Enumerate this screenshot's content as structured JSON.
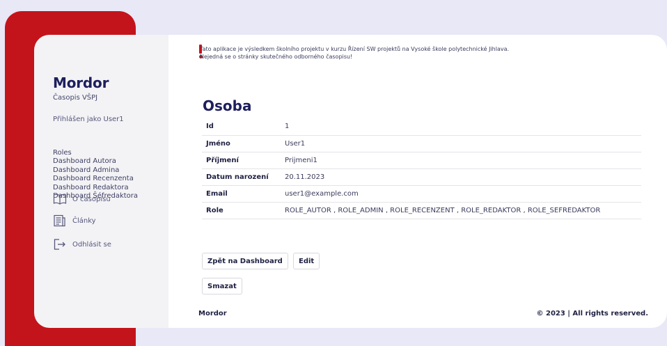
{
  "sidebar": {
    "brand": "Mordor",
    "subtitle": "Časopis VŠPJ",
    "logged_in": "Přihlášen jako User1",
    "menu": [
      "Roles",
      "Dashboard Autora",
      "Dashboard Admina",
      "Dashboard Recenzenta",
      "Dashboard Redaktora",
      "Dashboard Šéfredaktora"
    ],
    "about_label": "O časopisu",
    "articles_label": "Články",
    "logout_label": "Odhlásit se",
    "about_icon": "book-open-icon",
    "articles_icon": "newspaper-icon",
    "logout_icon": "logout-icon"
  },
  "notice": {
    "line1": "Tato aplikace je výsledkem školního projektu v kurzu Řízení SW projektů na Vysoké škole polytechnické Jihlava.",
    "line2": "Nejedná se o stránky skutečného odborného časopisu!",
    "icon": "exclamation-icon"
  },
  "page": {
    "title": "Osoba",
    "rows": [
      {
        "label": "Id",
        "value": "1"
      },
      {
        "label": "Jméno",
        "value": "User1"
      },
      {
        "label": "Příjmení",
        "value": "Prijmeni1"
      },
      {
        "label": "Datum narození",
        "value": "20.11.2023"
      },
      {
        "label": "Email",
        "value": "user1@example.com"
      },
      {
        "label": "Role",
        "value": "ROLE_AUTOR , ROLE_ADMIN , ROLE_RECENZENT , ROLE_REDAKTOR , ROLE_SEFREDAKTOR"
      }
    ],
    "back_button": "Zpět na Dashboard",
    "edit_button": "Edit",
    "delete_button": "Smazat"
  },
  "footer": {
    "left": "Mordor",
    "right": "© 2023 | All rights reserved."
  },
  "colors": {
    "accent_red": "#c4141b",
    "brand_navy": "#1d1f5c",
    "background": "#e8e8f6"
  }
}
